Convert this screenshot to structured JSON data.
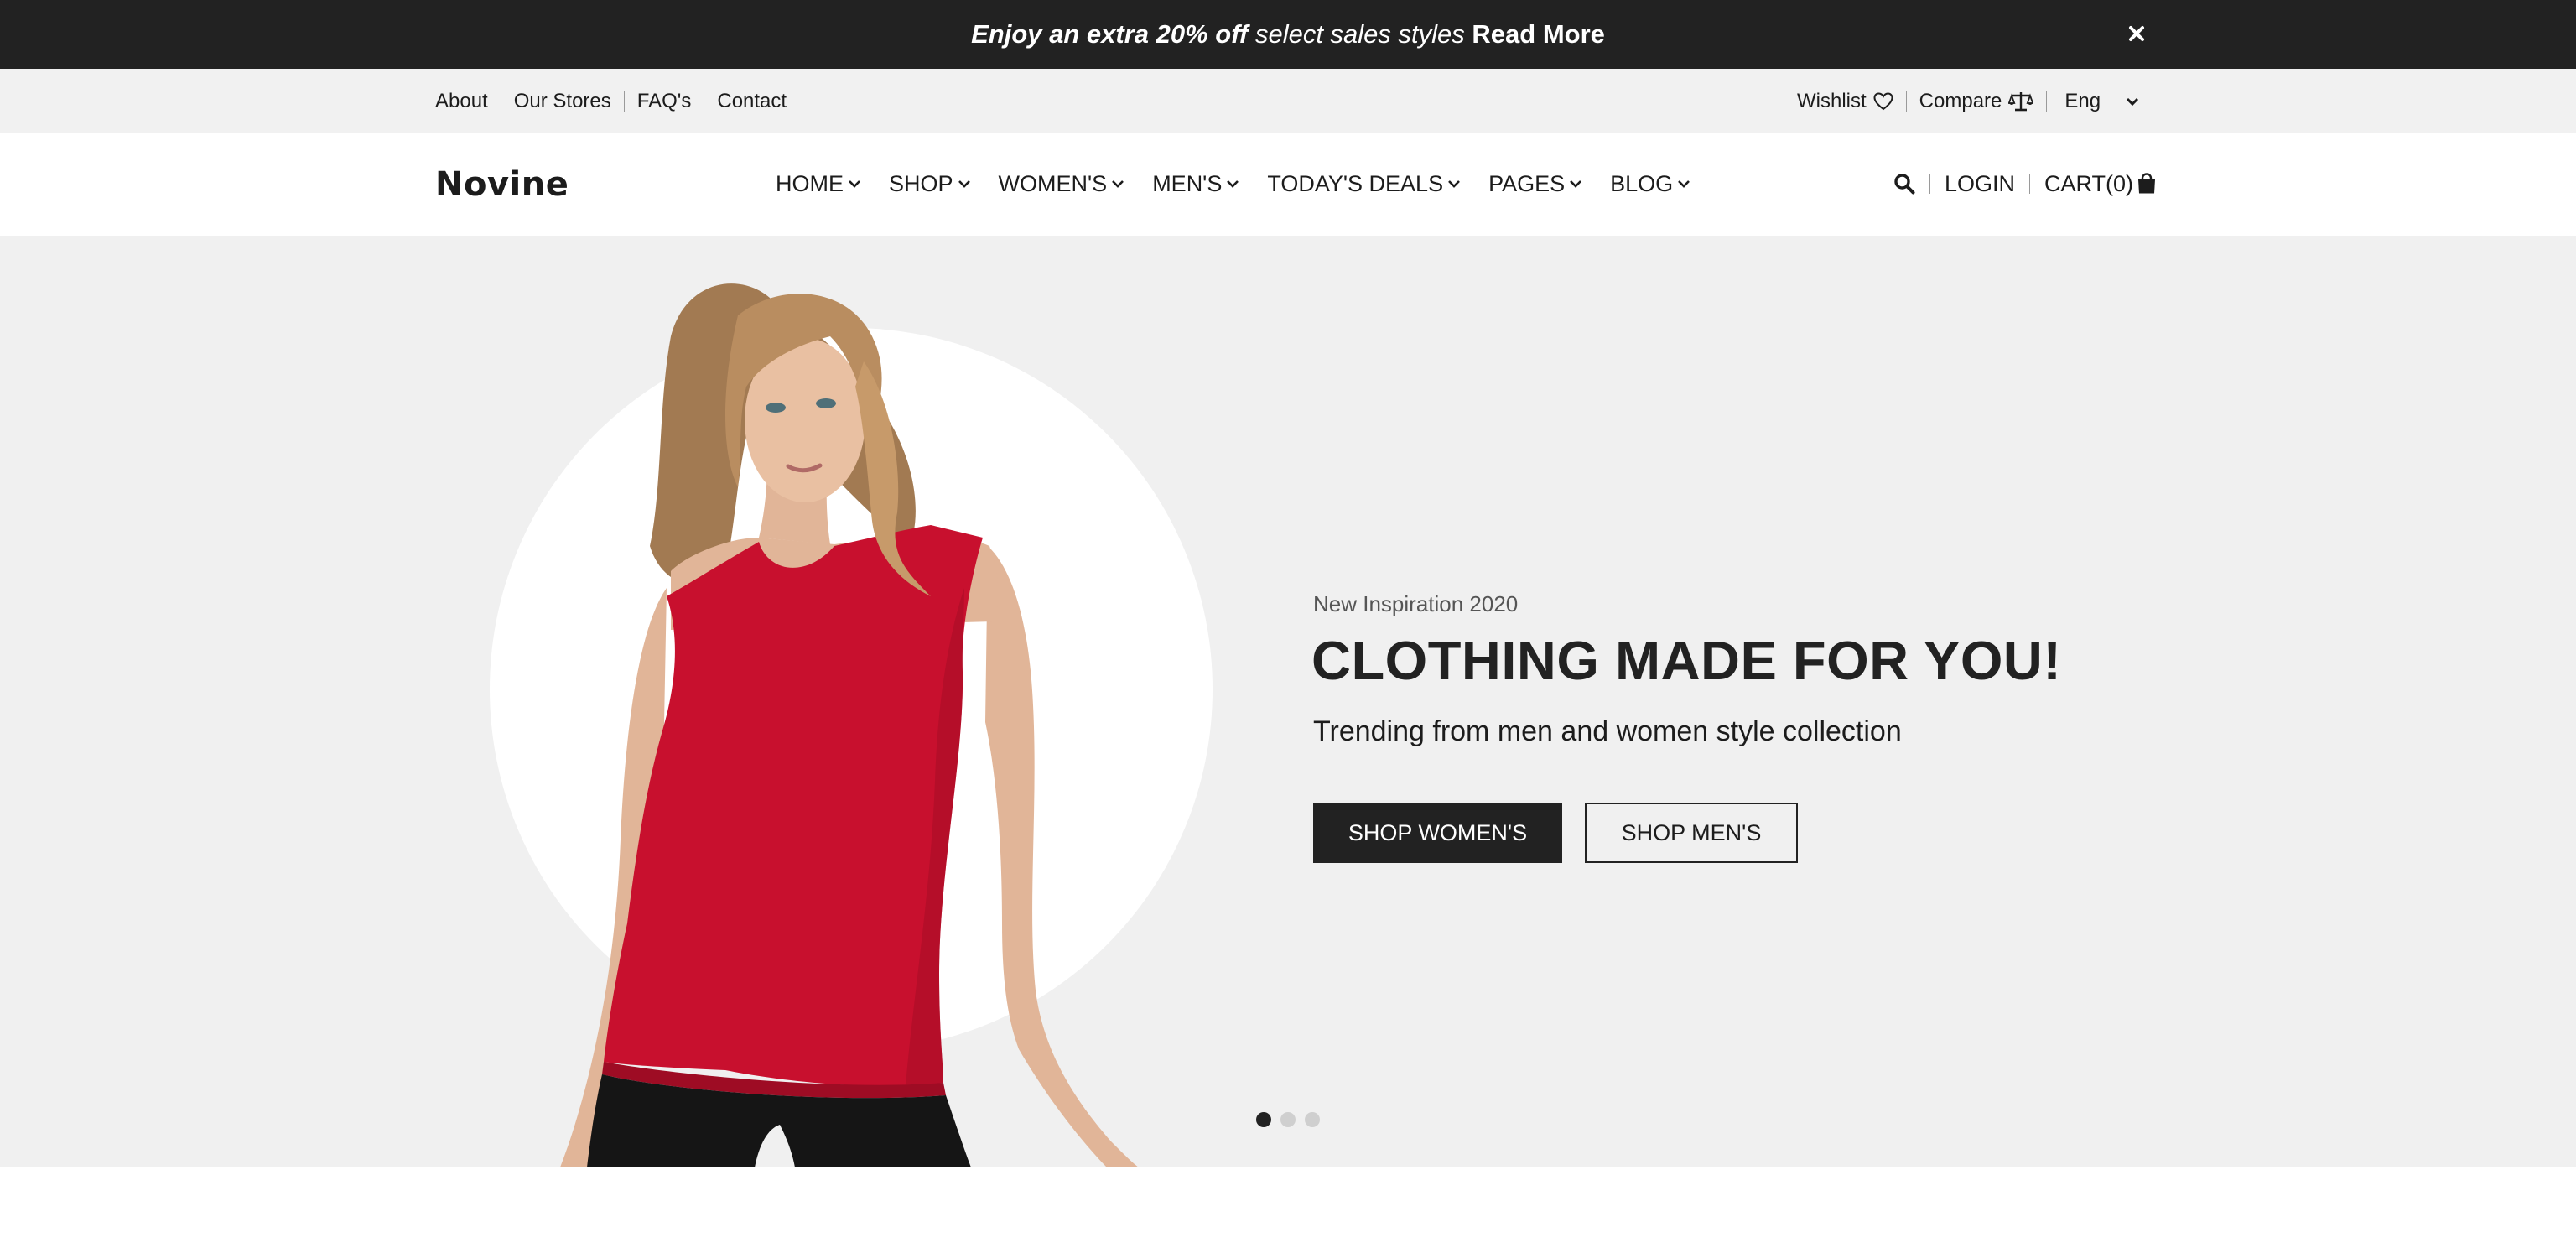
{
  "announcement": {
    "part1": "Enjoy an extra 20% off",
    "part2": "select sales styles",
    "link": "Read More",
    "close_icon": "close-icon"
  },
  "topbar": {
    "links": [
      "About",
      "Our Stores",
      "FAQ's",
      "Contact"
    ],
    "wishlist": "Wishlist",
    "compare": "Compare",
    "language": "Eng"
  },
  "header": {
    "logo": "Novine",
    "nav": [
      "HOME",
      "SHOP",
      "WOMEN'S",
      "MEN'S",
      "TODAY'S DEALS",
      "PAGES",
      "BLOG"
    ],
    "login": "LOGIN",
    "cart": "CART(0)"
  },
  "hero": {
    "eyebrow": "New Inspiration 2020",
    "headline": "CLOTHING MADE FOR YOU!",
    "subline": "Trending from men and women style collection",
    "btn_women": "SHOP WOMEN'S",
    "btn_men": "SHOP MEN'S",
    "slides": 3,
    "active_slide": 1
  },
  "colors": {
    "dark": "#222222",
    "light_bg": "#f0f0f0",
    "top_bg": "#f1f1f1",
    "top_red": "#c8102e"
  }
}
